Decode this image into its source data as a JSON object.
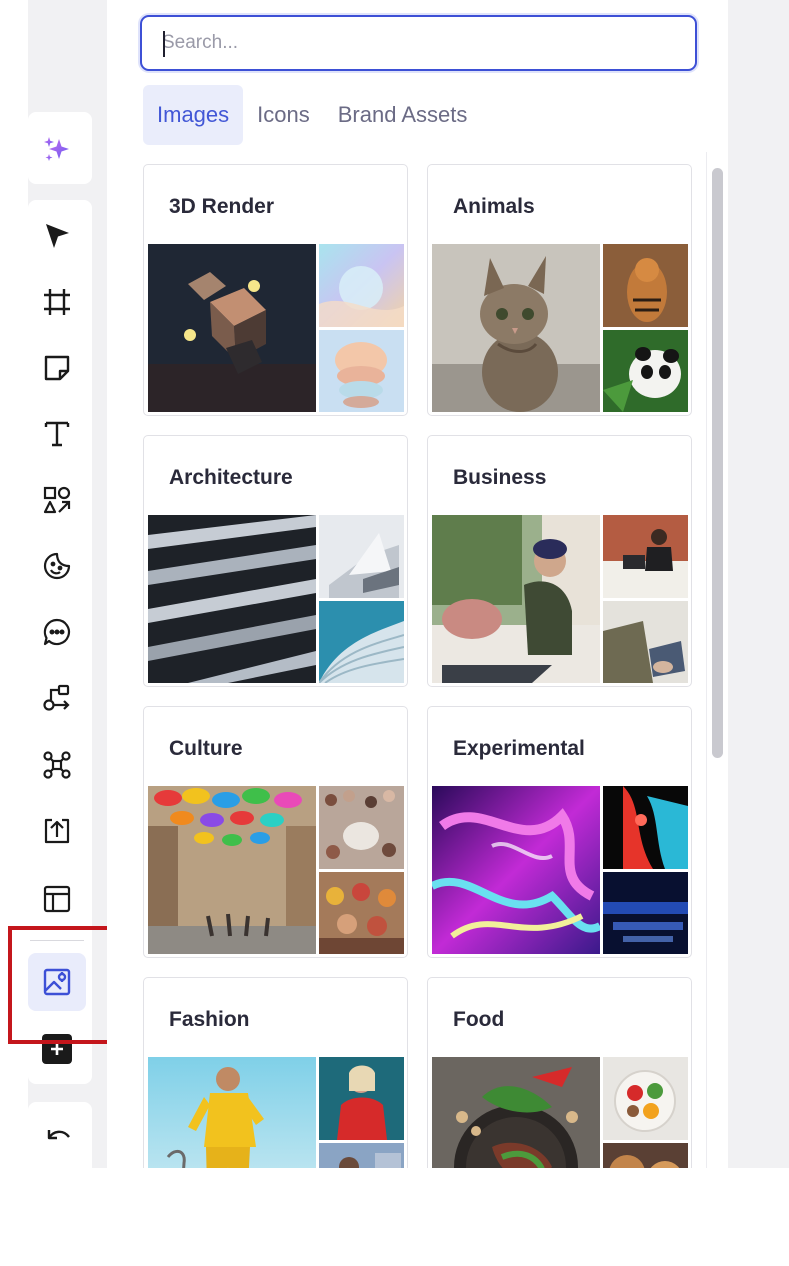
{
  "search": {
    "placeholder": "Search..."
  },
  "tabs": [
    {
      "label": "Images",
      "active": true
    },
    {
      "label": "Icons",
      "active": false
    },
    {
      "label": "Brand Assets",
      "active": false
    }
  ],
  "categories": [
    {
      "title": "3D Render"
    },
    {
      "title": "Animals"
    },
    {
      "title": "Architecture"
    },
    {
      "title": "Business"
    },
    {
      "title": "Culture"
    },
    {
      "title": "Experimental"
    },
    {
      "title": "Fashion"
    },
    {
      "title": "Food"
    }
  ],
  "toolbar": {
    "tools": [
      "ai-sparkle-icon",
      "select-arrow-icon",
      "frame-icon",
      "sticky-note-icon",
      "text-icon",
      "shapes-icon",
      "sticker-icon",
      "comment-icon",
      "connector-icon",
      "mindmap-icon",
      "upload-icon",
      "templates-icon",
      "image-icon",
      "add-icon",
      "undo-icon"
    ],
    "active_tool": "image-icon"
  },
  "colors": {
    "accent": "#4257d6",
    "highlight": "#c4161c",
    "panel_bg": "#ffffff",
    "toolbar_bg": "#f1f1f3"
  }
}
